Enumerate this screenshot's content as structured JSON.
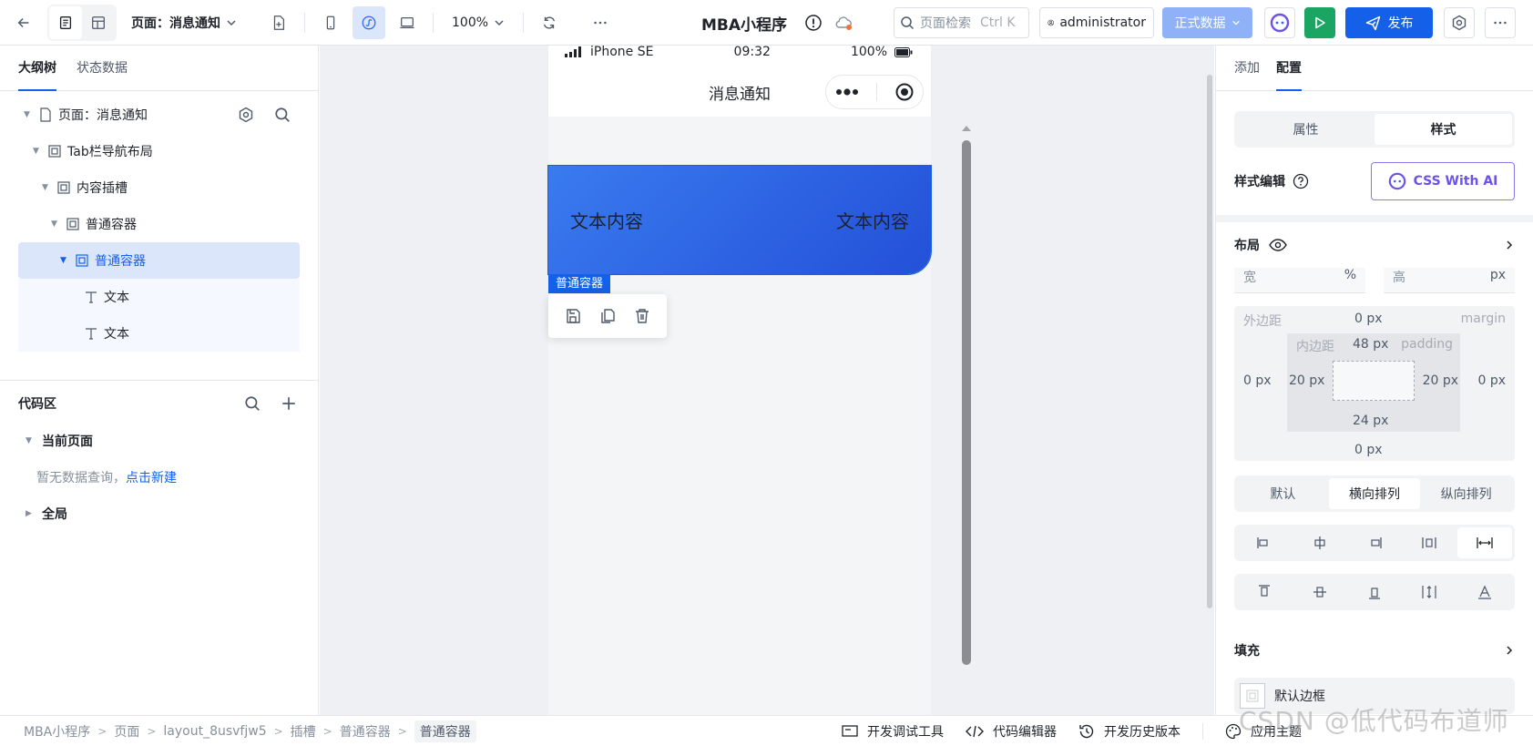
{
  "topbar": {
    "page_select": "页面：消息通知",
    "zoom": "100%",
    "app_title": "MBA小程序",
    "search_placeholder": "页面检索",
    "search_shortcut": "Ctrl K",
    "user": "administrator",
    "env": "正式数据",
    "publish": "发布"
  },
  "left": {
    "tabs": [
      "大纲树",
      "状态数据"
    ],
    "tree": [
      {
        "label": "页面：消息通知"
      },
      {
        "label": "Tab栏导航布局"
      },
      {
        "label": "内容插槽"
      },
      {
        "label": "普通容器"
      },
      {
        "label": "普通容器"
      },
      {
        "label": "文本"
      },
      {
        "label": "文本"
      }
    ],
    "code": {
      "title": "代码区",
      "current_page": "当前页面",
      "empty_hint": "暂无数据查询，",
      "create_link": "点击新建",
      "global": "全局"
    }
  },
  "canvas": {
    "status": {
      "device": "iPhone SE",
      "time": "09:32",
      "battery": "100%"
    },
    "nav_title": "消息通知",
    "banner_left": "文本内容",
    "banner_right": "文本内容",
    "selection_label": "普通容器"
  },
  "right": {
    "tabs": [
      "添加",
      "配置"
    ],
    "seg": [
      "属性",
      "样式"
    ],
    "style_edit": "样式编辑",
    "css_ai": "CSS With AI",
    "layout": "布局",
    "width_label": "宽",
    "width_unit": "%",
    "height_label": "高",
    "height_unit": "px",
    "margin_label": "外边距",
    "margin_en": "margin",
    "padding_label": "内边距",
    "padding_en": "padding",
    "margin_top": "0 px",
    "margin_bottom": "0 px",
    "margin_left": "0 px",
    "margin_right": "0 px",
    "padding_top": "48 px",
    "padding_bottom": "24 px",
    "padding_left": "20 px",
    "padding_right": "20 px",
    "flow": [
      "默认",
      "横向排列",
      "纵向排列"
    ],
    "fill": "填充",
    "default_border": "默认边框"
  },
  "bottom": {
    "crumbs": [
      "MBA小程序",
      "页面",
      "layout_8usvfjw5",
      "插槽",
      "普通容器",
      "普通容器"
    ],
    "tools": [
      "开发调试工具",
      "代码编辑器",
      "开发历史版本",
      "应用主题"
    ]
  },
  "watermark": "CSDN @低代码布道师",
  "colors": {
    "accent": "#1560e8",
    "banner_start": "#3a7bef",
    "banner_end": "#2350d8",
    "run": "#1aa563",
    "env": "#8fb1f7"
  }
}
